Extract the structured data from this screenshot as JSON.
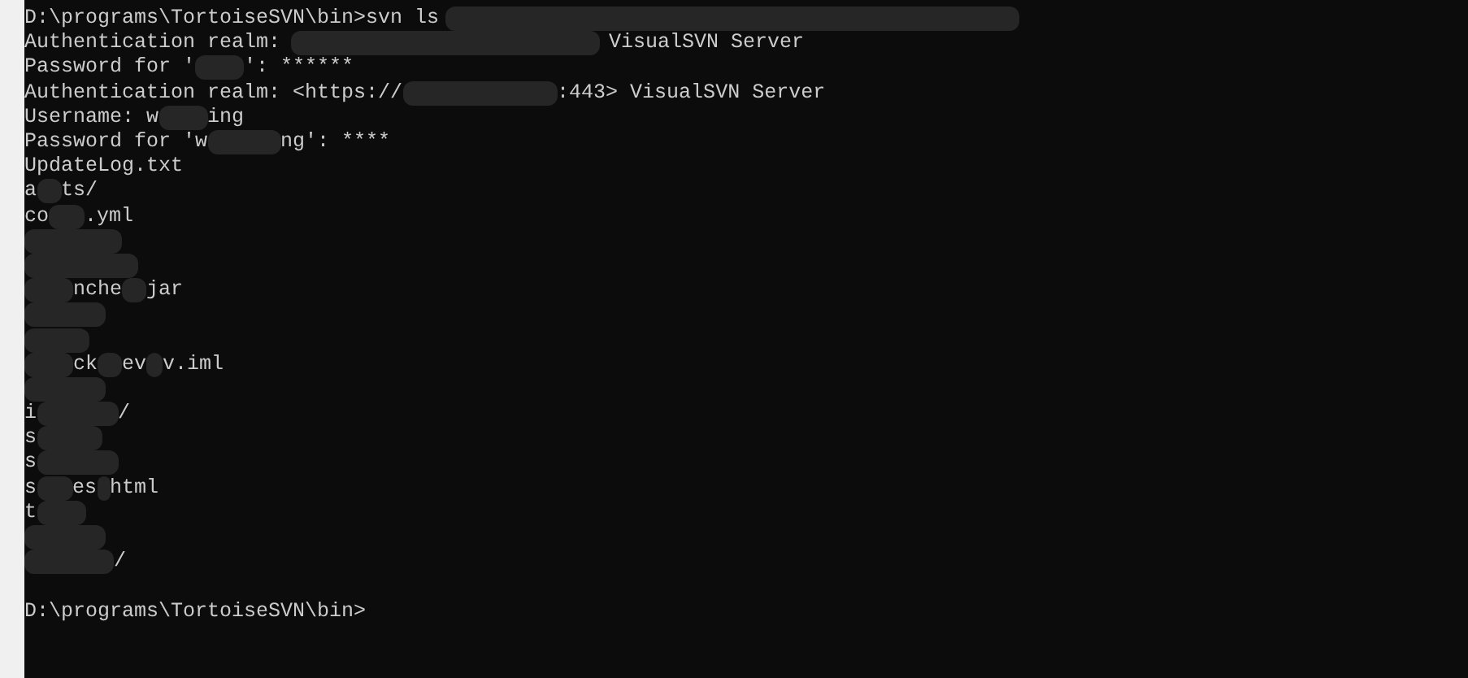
{
  "terminal": {
    "lines": [
      {
        "kind": "output",
        "segments": [
          {
            "kind": "text",
            "text": "D:\\programs\\TortoiseSVN\\bin>svn ls"
          },
          {
            "kind": "redacted"
          }
        ]
      },
      {
        "kind": "output",
        "segments": [
          {
            "kind": "text",
            "text": "Authentication realm:"
          },
          {
            "kind": "redacted"
          },
          {
            "kind": "text",
            "text": "VisualSVN Server"
          }
        ]
      },
      {
        "kind": "output",
        "segments": [
          {
            "kind": "text",
            "text": "Password for '"
          },
          {
            "kind": "redacted"
          },
          {
            "kind": "text",
            "text": "': ******"
          }
        ]
      },
      {
        "kind": "output",
        "segments": [
          {
            "kind": "text",
            "text": "Authentication realm: <https://"
          },
          {
            "kind": "redacted"
          },
          {
            "kind": "text",
            "text": ":443> VisualSVN Server"
          }
        ]
      },
      {
        "kind": "output",
        "segments": [
          {
            "kind": "text",
            "text": "Username: w"
          },
          {
            "kind": "redacted"
          },
          {
            "kind": "text",
            "text": "ing"
          }
        ]
      },
      {
        "kind": "output",
        "segments": [
          {
            "kind": "text",
            "text": "Password for 'w"
          },
          {
            "kind": "redacted"
          },
          {
            "kind": "text",
            "text": "ng': ****"
          }
        ]
      },
      {
        "kind": "output",
        "segments": [
          {
            "kind": "text",
            "text": "UpdateLog.txt"
          }
        ]
      },
      {
        "kind": "output",
        "segments": [
          {
            "kind": "text",
            "text": "a"
          },
          {
            "kind": "redacted"
          },
          {
            "kind": "text",
            "text": "ts/"
          }
        ]
      },
      {
        "kind": "output",
        "segments": [
          {
            "kind": "text",
            "text": "co"
          },
          {
            "kind": "redacted"
          },
          {
            "kind": "text",
            "text": ".yml"
          }
        ]
      },
      {
        "kind": "output",
        "segments": [
          {
            "kind": "redacted"
          }
        ]
      },
      {
        "kind": "output",
        "segments": [
          {
            "kind": "redacted"
          }
        ]
      },
      {
        "kind": "output",
        "segments": [
          {
            "kind": "redacted"
          },
          {
            "kind": "text",
            "text": "nche"
          },
          {
            "kind": "redacted"
          },
          {
            "kind": "text",
            "text": "jar"
          }
        ]
      },
      {
        "kind": "output",
        "segments": [
          {
            "kind": "redacted"
          }
        ]
      },
      {
        "kind": "output",
        "segments": [
          {
            "kind": "redacted"
          }
        ]
      },
      {
        "kind": "output",
        "segments": [
          {
            "kind": "redacted"
          },
          {
            "kind": "text",
            "text": "ck"
          },
          {
            "kind": "redacted"
          },
          {
            "kind": "text",
            "text": "ev"
          },
          {
            "kind": "redacted"
          },
          {
            "kind": "text",
            "text": "v.iml"
          }
        ]
      },
      {
        "kind": "output",
        "segments": [
          {
            "kind": "redacted"
          }
        ]
      },
      {
        "kind": "output",
        "segments": [
          {
            "kind": "text",
            "text": "i"
          },
          {
            "kind": "redacted"
          },
          {
            "kind": "text",
            "text": "/"
          }
        ]
      },
      {
        "kind": "output",
        "segments": [
          {
            "kind": "text",
            "text": "s"
          },
          {
            "kind": "redacted"
          }
        ]
      },
      {
        "kind": "output",
        "segments": [
          {
            "kind": "text",
            "text": "s"
          },
          {
            "kind": "redacted"
          }
        ]
      },
      {
        "kind": "output",
        "segments": [
          {
            "kind": "text",
            "text": "s"
          },
          {
            "kind": "redacted"
          },
          {
            "kind": "text",
            "text": "es"
          },
          {
            "kind": "redacted"
          },
          {
            "kind": "text",
            "text": "html"
          }
        ]
      },
      {
        "kind": "output",
        "segments": [
          {
            "kind": "text",
            "text": "t"
          },
          {
            "kind": "redacted"
          }
        ]
      },
      {
        "kind": "output",
        "segments": [
          {
            "kind": "redacted"
          }
        ]
      },
      {
        "kind": "output",
        "segments": [
          {
            "kind": "redacted"
          },
          {
            "kind": "text",
            "text": "/"
          }
        ]
      },
      {
        "kind": "blank"
      },
      {
        "kind": "output",
        "segments": [
          {
            "kind": "text",
            "text": "D:\\programs\\TortoiseSVN\\bin>"
          }
        ]
      }
    ]
  }
}
